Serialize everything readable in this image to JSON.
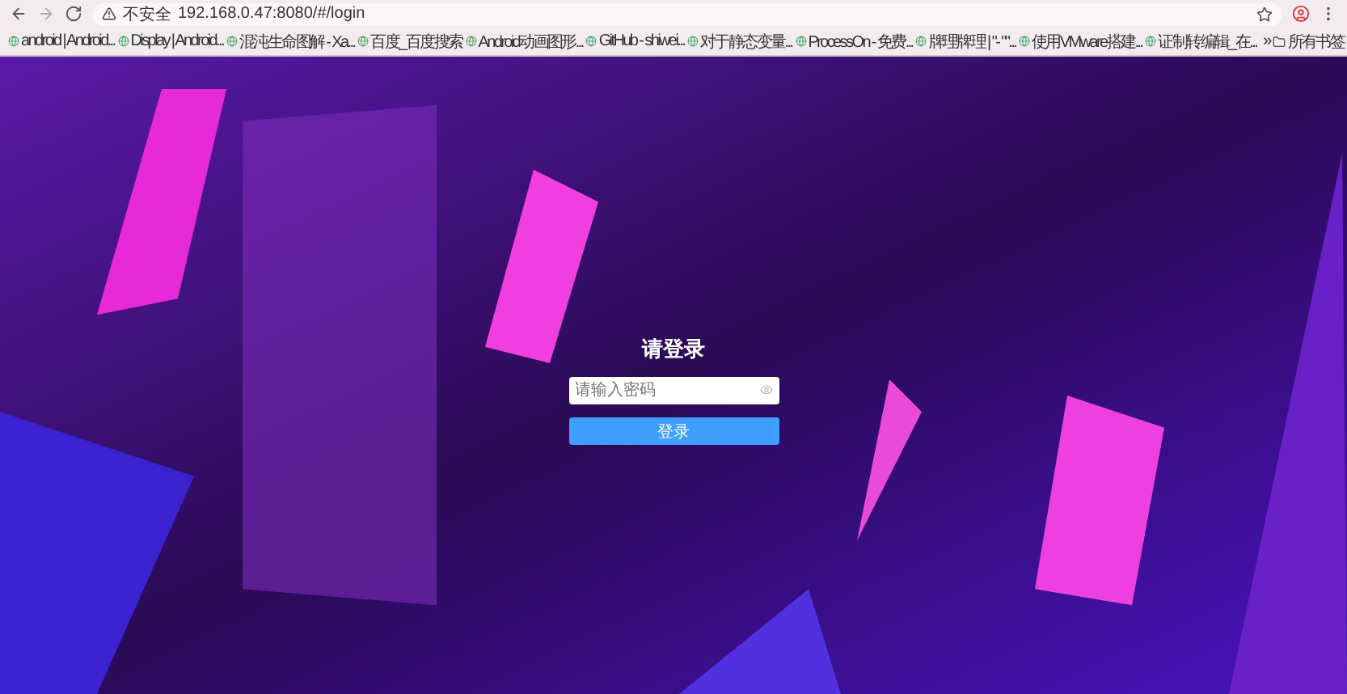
{
  "browser": {
    "security": "不安全",
    "url": "192.168.0.47:8080/#/login",
    "bookmarks": [
      "android | Android...",
      "Display | Android...",
      "混沌生命图解 - Xa...",
      "百度_百度搜索",
      "Android动画图形...",
      "GitHub - shiwei...",
      "对于静态变量...",
      "ProcessOn - 免费...",
      "牌理牌理 | \"- \"\"...",
      "使用VMware搭建...",
      "证制转编辑_在..."
    ],
    "more": "»",
    "all_bookmarks": "所有书签"
  },
  "login": {
    "title": "请登录",
    "password_placeholder": "请输入密码",
    "submit": "登录"
  }
}
